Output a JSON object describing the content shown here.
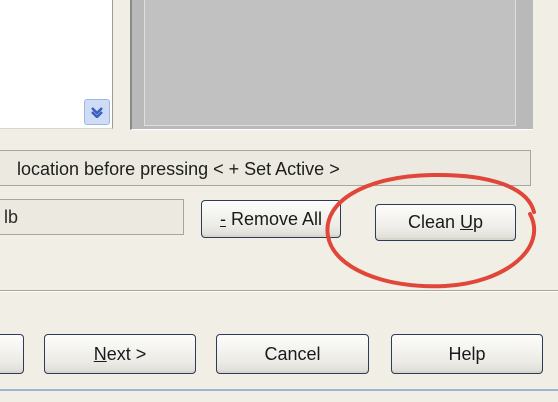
{
  "status": {
    "text": "location before pressing < + Set Active >"
  },
  "name_field": {
    "value": "lb"
  },
  "buttons": {
    "remove_all": {
      "mnemonic": "-",
      "rest": " Remove All"
    },
    "clean_up": {
      "before": "Clean ",
      "mnemonic": "U",
      "rest": "p"
    },
    "next": {
      "mnemonic": "N",
      "rest": "ext >"
    },
    "cancel": {
      "label": "Cancel"
    },
    "help": {
      "label": "Help"
    }
  },
  "icons": {
    "scroll_down": "chevron-down-icon"
  },
  "colors": {
    "dialog_bg": "#f0eee5",
    "preview_bg": "#b9b9b9",
    "highlight": "#e0473a",
    "accent_blue": "#9fb3d4"
  }
}
